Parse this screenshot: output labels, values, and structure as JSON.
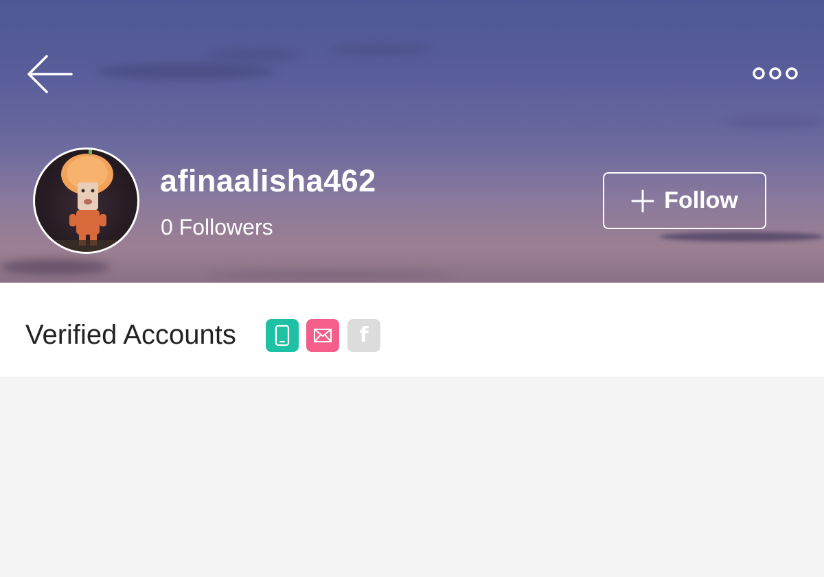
{
  "profile": {
    "username": "afinaalisha462",
    "followers_text": "0 Followers",
    "follow_label": "Follow",
    "avatar_description": "avatar"
  },
  "icons": {
    "back": "back-arrow-icon",
    "more": "more-options-icon",
    "plus": "plus-icon",
    "phone": "phone-icon",
    "mail": "mail-icon",
    "facebook": "facebook-icon"
  },
  "verified": {
    "label": "Verified Accounts",
    "facebook_letter": "f"
  },
  "colors": {
    "phone_badge": "#1ec1a4",
    "mail_badge": "#f35f8a",
    "facebook_badge": "#dcdcdc",
    "page_background": "#f4f4f4"
  }
}
